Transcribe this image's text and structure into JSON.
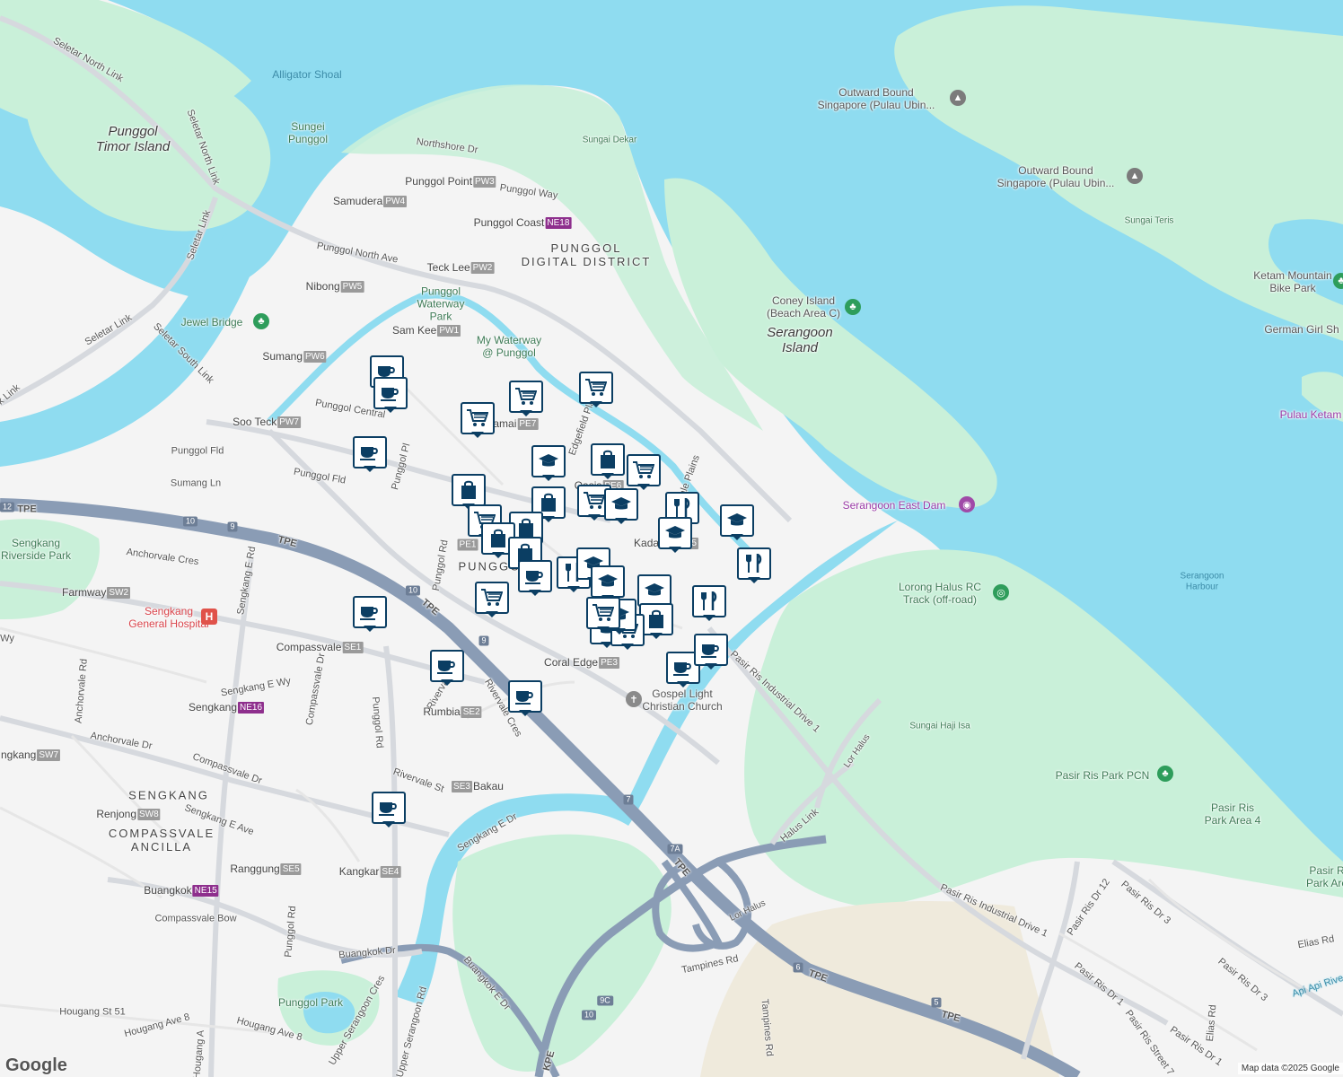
{
  "map": {
    "water_color": "#8fdcf0",
    "park_color": "#c9f0d9",
    "land_color": "#f4f4f4",
    "expressway_color": "#8a9cb5",
    "pin_border_color": "#0b3e63"
  },
  "labels": {
    "alligator_shoal": "Alligator Shoal",
    "sungei_punggol": "Sungei\nPunggol",
    "punggol_timor": "Punggol\nTimor Island",
    "outward_bound_1": "Outward Bound\nSingapore (Pulau Ubin...",
    "outward_bound_2": "Outward Bound\nSingapore (Pulau Ubin...",
    "sungei_teris": "Sungai Teris",
    "sungai_dekar": "Sungai Dekar",
    "northshore_dr": "Northshore Dr",
    "punggol_way": "Punggol Way",
    "ketam_mountain": "Ketam Mountain\nBike Park",
    "german_girl": "German Girl Sh",
    "pulau_ketam": "Pulau Ketam",
    "coney_island": "Coney Island\n(Beach Area C)",
    "serangoon_island": "Serangoon\nIsland",
    "punggol_digital": "PUNGGOL\nDIGITAL DISTRICT",
    "punggol_waterway_park": "Punggol\nWaterway\nPark",
    "my_waterway": "My Waterway\n@ Punggol",
    "jewel_bridge": "Jewel Bridge",
    "serangoon_east_dam": "Serangoon East Dam",
    "lorong_halus": "Lorong Halus RC\nTrack (off-road)",
    "serangoon_harbour": "Serangoon\nHarbour",
    "sungai_haji_isa": "Sungai Haji Isa",
    "pasir_ris_pcn": "Pasir Ris Park PCN",
    "pasir_ris_area4": "Pasir Ris\nPark Area 4",
    "pasir_ris_park": "Pasir R\nPark Are",
    "sengkang_riverside": "Sengkang\nRiverside Park",
    "sengkang_hospital": "Sengkang\nGeneral Hospital",
    "gospel_light": "Gospel Light\nChristian Church",
    "punggol_town": "PUNGGOL",
    "sengkang_town": "SENGKANG",
    "compassvale_ancilla": "COMPASSVALE\nANCILLA",
    "punggol_park": "Punggol Park",
    "api_api": "Api Api Rive",
    "seletar_north_link_1": "Seletar North Link",
    "seletar_north_link_2": "Seletar North Link",
    "seletar_link": "Seletar Link",
    "seletar_south_link": "Seletar South Link",
    "seletar_link_2": "Seletar Link",
    "punggol_north_ave": "Punggol North Ave",
    "punggol_central": "Punggol Central",
    "punggol_fld_1": "Punggol Fld",
    "punggol_fld_2": "Punggol Fld",
    "sumang_ln": "Sumang Ln",
    "punggol_pl": "Punggol Pl",
    "anchorvale_cres": "Anchorvale Cres",
    "sengkang_e_rd": "Sengkang E Rd",
    "punggol_rd_1": "Punggol Rd",
    "punggol_rd_2": "Punggol Rd",
    "punggol_rd_3": "Punggol Rd",
    "edgefield_plains": "Edgefield Plains",
    "edgedale_plains": "Edgedale Plains",
    "pasir_ris_ind_1": "Pasir Ris Industrial Drive 1",
    "pasir_ris_ind_2": "Pasir Ris Industrial Drive 1",
    "halus_link": "Halus Link",
    "lor_halus_1": "Lor Halus",
    "lor_halus_2": "Lor Halus",
    "tampines_rd_1": "Tampines Rd",
    "tampines_rd_2": "Tampines Rd",
    "anchorvale_rd_1": "Anchorvale Rd",
    "anchorvale_dr": "Anchorvale Dr",
    "compassvale_dr_1": "Compassvale Dr",
    "compassvale_dr_2": "Compassvale Dr",
    "sengkang_e_wy": "Sengkang E Wy",
    "sengkang_e_ave": "Sengkang E Ave",
    "rivervale_cres": "Rivervale Cres",
    "rivervale_dr_1": "Rivervale Dr",
    "rivervale_st": "Rivervale St",
    "sengkang_e_dr": "Sengkang E Dr",
    "compassvale_bow": "Compassvale Bow",
    "buangkok_dr": "Buangkok Dr",
    "buangkok_e_dr": "Buangkok E Dr",
    "upper_serangoon_rd": "Upper Serangoon Rd",
    "upper_serangoon_cres": "Upper Serangoon Cres",
    "hougang_st_51": "Hougang St 51",
    "hougang_ave_8_1": "Hougang Ave 8",
    "hougang_ave_8_2": "Hougang Ave 8",
    "hougang_a": "Hougang A",
    "kpe": "KPE",
    "tpe_1": "TPE",
    "tpe_2": "TPE",
    "tpe_3": "TPE",
    "tpe_4": "TPE",
    "tpe_5": "TPE",
    "tpe_6": "TPE",
    "pasir_ris_dr_12": "Pasir Ris Dr 12",
    "pasir_ris_dr_3": "Pasir Ris Dr 3",
    "pasir_ris_dr_1_a": "Pasir Ris Dr 1",
    "pasir_ris_dr_1_b": "Pasir Ris Dr 1",
    "pasir_ris_dr_3_b": "Pasir Ris Dr 3",
    "pasir_ris_street_7": "Pasir Ris Street 7",
    "elias_rd_1": "Elias Rd",
    "elias_rd_2": "Elias Rd",
    "wy": "Wy",
    "ngkang": "ngkang",
    "k_link": "k Link"
  },
  "stations": [
    {
      "name": "Samudera",
      "code": "PW4",
      "line": "lrt"
    },
    {
      "name": "Punggol Point",
      "code": "PW3",
      "line": "lrt"
    },
    {
      "name": "Punggol Coast",
      "code": "NE18",
      "line": "ne"
    },
    {
      "name": "Teck Lee",
      "code": "PW2",
      "line": "lrt"
    },
    {
      "name": "Nibong",
      "code": "PW5",
      "line": "lrt"
    },
    {
      "name": "Sam Kee",
      "code": "PW1",
      "line": "lrt"
    },
    {
      "name": "Sumang",
      "code": "PW6",
      "line": "lrt"
    },
    {
      "name": "Soo Teck",
      "code": "PW7",
      "line": "lrt"
    },
    {
      "name": "Damai",
      "code": "PE7",
      "line": "lrt"
    },
    {
      "name": "Oasis",
      "code": "PE6",
      "line": "lrt"
    },
    {
      "name": "Kadaloor",
      "code": "PE5",
      "line": "lrt"
    },
    {
      "name": "Farmway",
      "code": "SW2",
      "line": "lrt"
    },
    {
      "name": "Compassvale",
      "code": "SE1",
      "line": "lrt"
    },
    {
      "name": "Coral Edge",
      "code": "PE3",
      "line": "lrt"
    },
    {
      "name": "Sengkang",
      "code": "NE16",
      "line": "ne"
    },
    {
      "name": "Rumbia",
      "code": "SE2",
      "line": "lrt"
    },
    {
      "name": "Bakau",
      "code": "SE3",
      "line": "lrt"
    },
    {
      "name": "Renjong",
      "code": "SW8",
      "line": "lrt"
    },
    {
      "name": "Ranggung",
      "code": "SE5",
      "line": "lrt"
    },
    {
      "name": "Kangkar",
      "code": "SE4",
      "line": "lrt"
    },
    {
      "name": "Buangkok",
      "code": "NE15",
      "line": "ne"
    },
    {
      "name": "ngkang",
      "code": "SW7",
      "line": "lrt"
    },
    {
      "name": "",
      "code": "PE1",
      "line": "lrt"
    }
  ],
  "highway_shields": [
    "12",
    "10",
    "9",
    "10",
    "9",
    "7",
    "7A",
    "6",
    "5",
    "9C",
    "10"
  ],
  "pins": [
    {
      "type": "cafe"
    },
    {
      "type": "cafe"
    },
    {
      "type": "grocery"
    },
    {
      "type": "grocery"
    },
    {
      "type": "grocery"
    },
    {
      "type": "cafe"
    },
    {
      "type": "school"
    },
    {
      "type": "shopping"
    },
    {
      "type": "grocery"
    },
    {
      "type": "shopping"
    },
    {
      "type": "grocery"
    },
    {
      "type": "shopping"
    },
    {
      "type": "grocery"
    },
    {
      "type": "school"
    },
    {
      "type": "restaurant"
    },
    {
      "type": "school"
    },
    {
      "type": "school"
    },
    {
      "type": "shopping"
    },
    {
      "type": "shopping"
    },
    {
      "type": "shopping"
    },
    {
      "type": "restaurant"
    },
    {
      "type": "cafe"
    },
    {
      "type": "restaurant"
    },
    {
      "type": "school"
    },
    {
      "type": "school"
    },
    {
      "type": "school"
    },
    {
      "type": "grocery"
    },
    {
      "type": "restaurant"
    },
    {
      "type": "shopping"
    },
    {
      "type": "school"
    },
    {
      "type": "grocery"
    },
    {
      "type": "cafe"
    },
    {
      "type": "cafe"
    },
    {
      "type": "cafe"
    },
    {
      "type": "cafe"
    },
    {
      "type": "cafe"
    },
    {
      "type": "cafe"
    },
    {
      "type": "school"
    },
    {
      "type": "grocery"
    }
  ],
  "footer": {
    "logo": "Google",
    "attribution": "Map data ©2025 Google"
  }
}
